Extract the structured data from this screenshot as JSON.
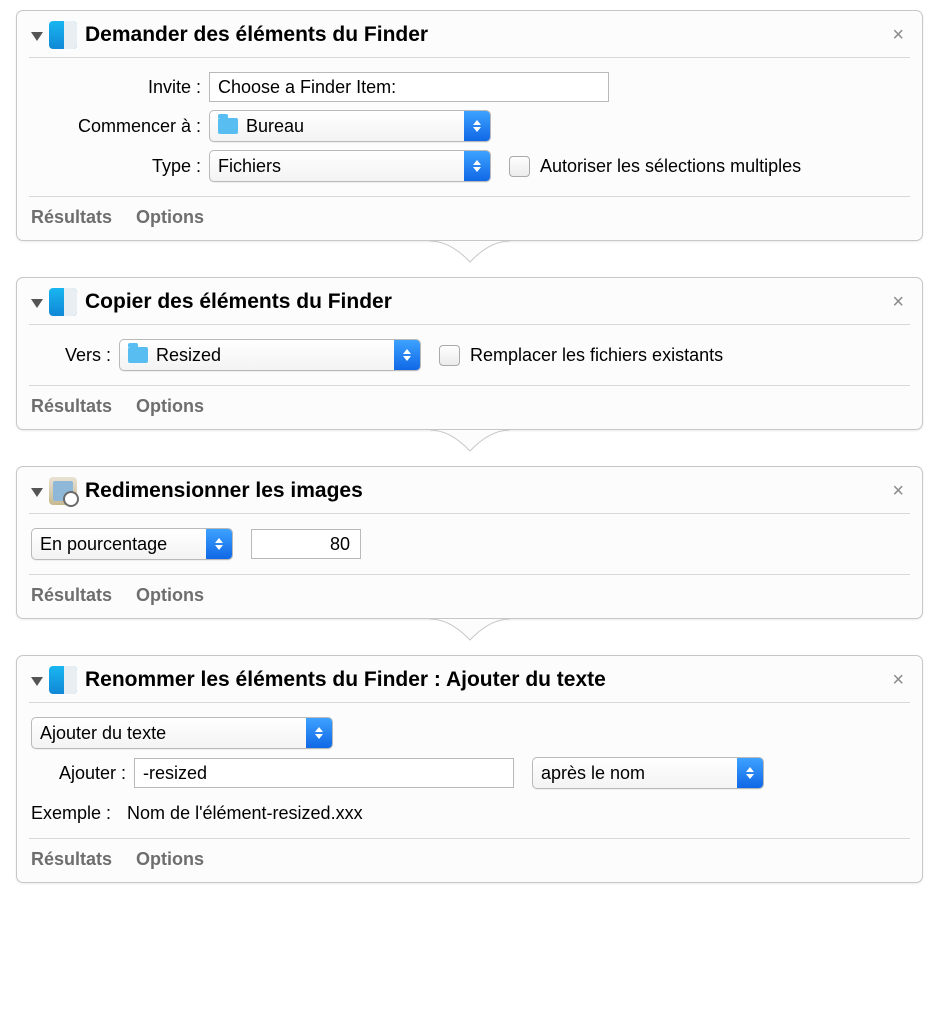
{
  "buttons": {
    "results": "Résultats",
    "options": "Options"
  },
  "actions": [
    {
      "title": "Demander des éléments du Finder",
      "form": {
        "invite_label": "Invite :",
        "invite_value": "Choose a Finder Item:",
        "start_label": "Commencer à :",
        "start_value": "Bureau",
        "type_label": "Type :",
        "type_value": "Fichiers",
        "multi_label": "Autoriser les sélections multiples"
      }
    },
    {
      "title": "Copier des éléments du Finder",
      "form": {
        "to_label": "Vers :",
        "to_value": "Resized",
        "replace_label": "Remplacer les fichiers existants"
      }
    },
    {
      "title": "Redimensionner les images",
      "form": {
        "mode_value": "En pourcentage",
        "amount_value": "80"
      }
    },
    {
      "title": "Renommer les éléments du Finder : Ajouter du texte",
      "form": {
        "mode_value": "Ajouter du texte",
        "add_label": "Ajouter :",
        "add_value": "-resized",
        "position_value": "après le nom",
        "example_label": "Exemple :",
        "example_value": "Nom de l'élément-resized.xxx"
      }
    }
  ]
}
